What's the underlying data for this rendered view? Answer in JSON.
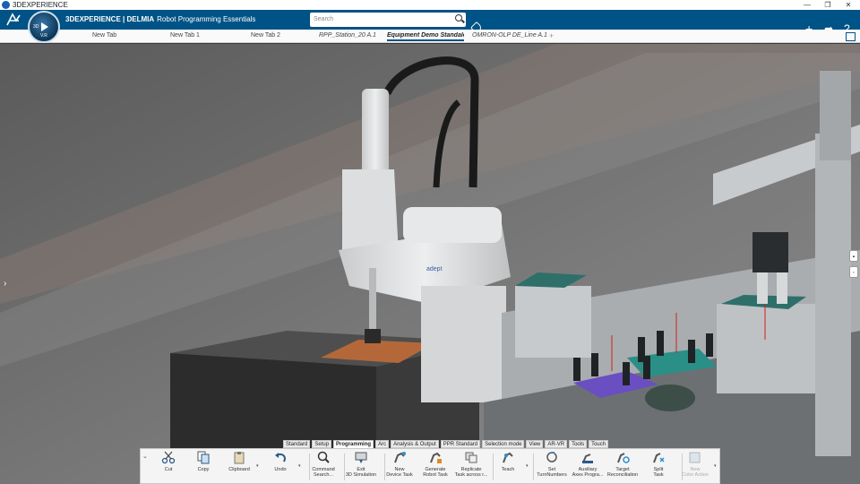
{
  "window": {
    "title": "3DEXPERIENCE",
    "controls": [
      "—",
      "❐",
      "✕"
    ]
  },
  "header": {
    "brand_bold": "3DEXPERIENCE | DELMIA",
    "app_name": "Robot Programming Essentials",
    "compass_version": "V.R",
    "compass_label": "3D",
    "search_placeholder": "Search",
    "brand_color": "#005386",
    "icons": [
      "plus-icon",
      "share-icon",
      "help-icon"
    ]
  },
  "tabs": [
    {
      "label": "New Tab",
      "style": "normal"
    },
    {
      "label": "New Tab 1",
      "style": "normal"
    },
    {
      "label": "New Tab 2",
      "style": "normal"
    },
    {
      "label": "RPP_Station_20 A.1",
      "style": "italic"
    },
    {
      "label": "Equipment Demo Standalo",
      "style": "active"
    },
    {
      "label": "OMRON-OLP DE_Line A.1",
      "style": "italic"
    }
  ],
  "viewport": {
    "robot_logo": "adept",
    "side_buttons": [
      "▲",
      "▪"
    ]
  },
  "action_bar": {
    "sections": [
      {
        "label": "Standard",
        "active": false
      },
      {
        "label": "Setup",
        "active": false
      },
      {
        "label": "Programming",
        "active": true
      },
      {
        "label": "Arc",
        "active": false
      },
      {
        "label": "Analysis & Output",
        "active": false
      },
      {
        "label": "PPR Standard",
        "active": false
      },
      {
        "label": "Selection mode",
        "active": false
      },
      {
        "label": "View",
        "active": false
      },
      {
        "label": "AR-VR",
        "active": false
      },
      {
        "label": "Tools",
        "active": false
      },
      {
        "label": "Touch",
        "active": false
      }
    ],
    "commands": [
      {
        "label": "Cut",
        "icon": "scissors-icon"
      },
      {
        "label": "Copy",
        "icon": "copy-icon"
      },
      {
        "label": "Clipboard",
        "icon": "clipboard-icon"
      },
      {
        "label": "Undo",
        "icon": "undo-icon"
      },
      {
        "label": "Command\nSearch...",
        "icon": "command-search-icon"
      },
      {
        "label": "Exit\n3D Simulation",
        "icon": "exit-simulation-icon"
      },
      {
        "label": "New\nDevice Task",
        "icon": "new-device-task-icon"
      },
      {
        "label": "Generate\nRobot Task",
        "icon": "generate-robot-task-icon"
      },
      {
        "label": "Replicate\nTask across r...",
        "icon": "replicate-task-icon"
      },
      {
        "label": "Teach",
        "icon": "teach-icon"
      },
      {
        "label": "Set\nTurnNumbers",
        "icon": "turn-numbers-icon"
      },
      {
        "label": "Auxiliary\nAxes Progra...",
        "icon": "auxiliary-axes-icon"
      },
      {
        "label": "Target\nReconciliation",
        "icon": "target-reconciliation-icon"
      },
      {
        "label": "Split\nTask",
        "icon": "split-task-icon"
      },
      {
        "label": "New\nColor Action",
        "icon": "new-color-action-icon",
        "disabled": true
      }
    ]
  }
}
